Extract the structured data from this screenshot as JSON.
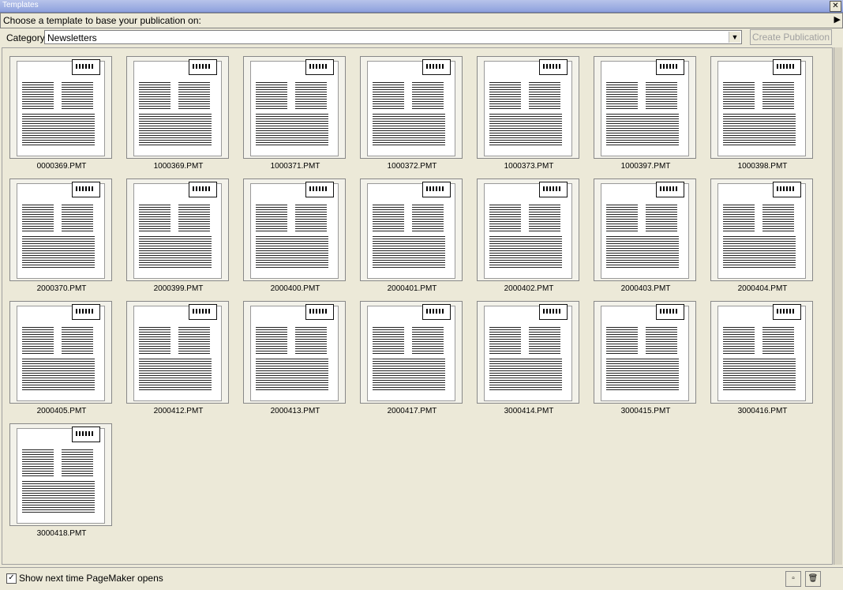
{
  "window": {
    "title": "Templates"
  },
  "prompt": "Choose a template to base your publication on:",
  "category": {
    "label": "Category:",
    "value": "Newsletters"
  },
  "actions": {
    "create_label": "Create Publication"
  },
  "templates": [
    "0000369.PMT",
    "1000369.PMT",
    "1000371.PMT",
    "1000372.PMT",
    "1000373.PMT",
    "1000397.PMT",
    "1000398.PMT",
    "2000370.PMT",
    "2000399.PMT",
    "2000400.PMT",
    "2000401.PMT",
    "2000402.PMT",
    "2000403.PMT",
    "2000404.PMT",
    "2000405.PMT",
    "2000412.PMT",
    "2000413.PMT",
    "2000417.PMT",
    "3000414.PMT",
    "3000415.PMT",
    "3000416.PMT",
    "3000418.PMT"
  ],
  "footer": {
    "show_next_label": "Show next time PageMaker opens",
    "show_next_checked": true
  },
  "icons": {
    "close": "close-icon",
    "arrow": "arrow-right-icon",
    "dropdown": "chevron-down-icon"
  }
}
